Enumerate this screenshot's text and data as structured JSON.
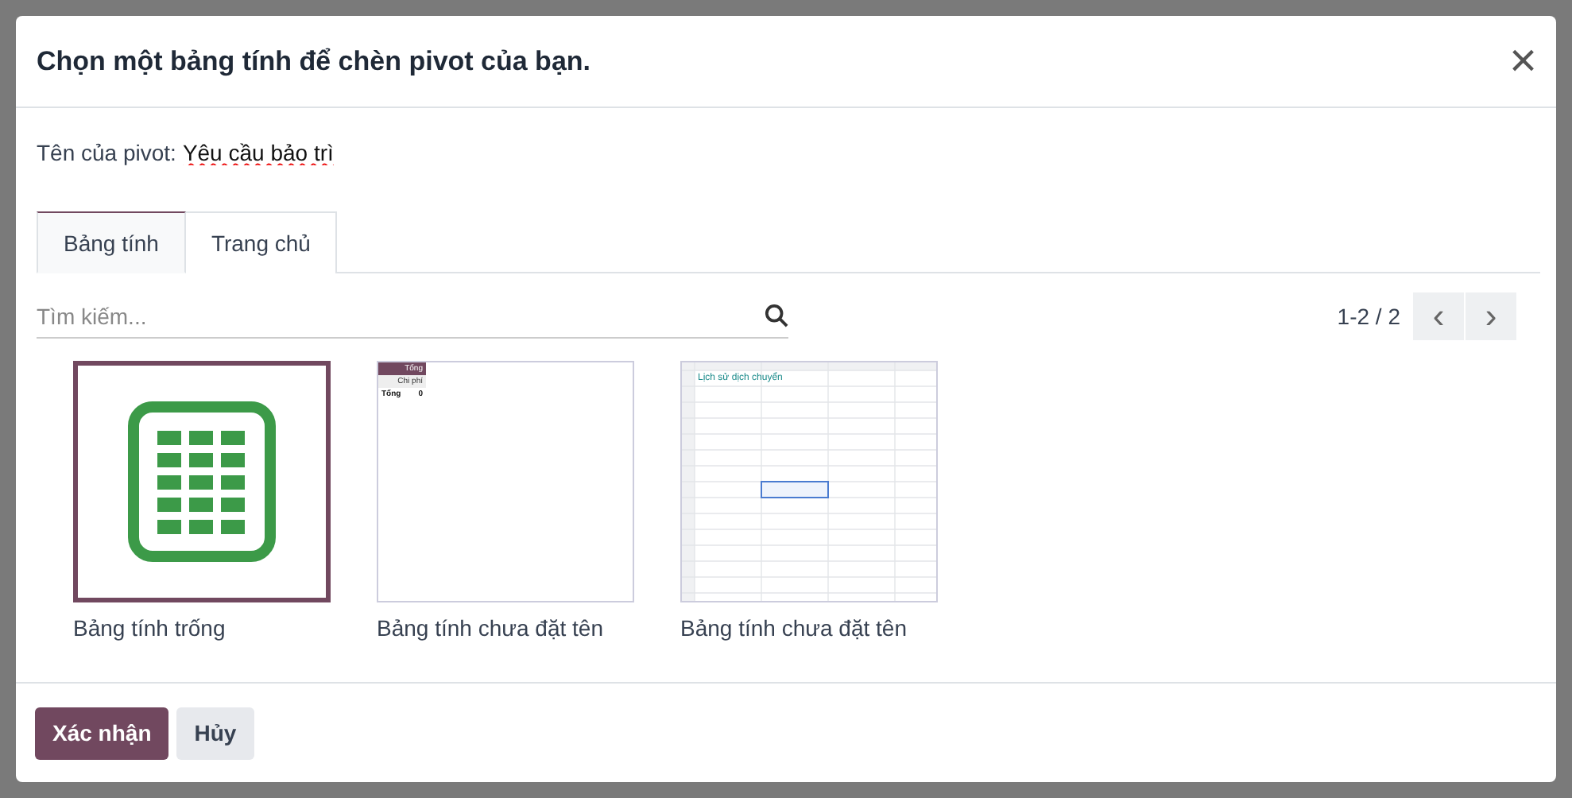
{
  "dialog": {
    "title": "Chọn một bảng tính để chèn pivot của bạn.",
    "close": "×"
  },
  "name_field": {
    "label": "Tên của pivot:",
    "value": "Yêu cầu bảo trì"
  },
  "tabs": [
    {
      "label": "Bảng tính",
      "selected": true
    },
    {
      "label": "Trang chủ",
      "selected": false
    }
  ],
  "search": {
    "placeholder": "Tìm kiếm..."
  },
  "pager": {
    "text": "1-2 / 2",
    "prev": "‹",
    "next": "›"
  },
  "items": [
    {
      "kind": "blank",
      "name": "Bảng tính trống",
      "selected": true
    },
    {
      "kind": "pivot",
      "name": "Bảng tính chưa đặt tên",
      "selected": false,
      "cells": [
        "Tổng",
        "Chi phí",
        "Tổng",
        "0"
      ]
    },
    {
      "kind": "grid",
      "name": "Bảng tính chưa đặt tên",
      "selected": false,
      "cells": [
        "Lịch sử dịch chuyển"
      ]
    }
  ],
  "buttons": [
    {
      "label": "Xác nhận",
      "kind": "primary"
    },
    {
      "label": "Hủy",
      "kind": "secondary"
    }
  ]
}
